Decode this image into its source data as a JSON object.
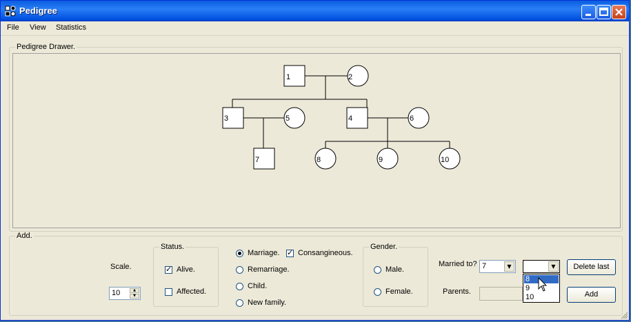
{
  "window": {
    "title": "Pedigree"
  },
  "menu": [
    "File",
    "View",
    "Statistics"
  ],
  "drawer": {
    "label": "Pedigree Drawer.",
    "nodes": [
      {
        "id": "1",
        "shape": "square"
      },
      {
        "id": "2",
        "shape": "circle"
      },
      {
        "id": "3",
        "shape": "square"
      },
      {
        "id": "4",
        "shape": "square"
      },
      {
        "id": "5",
        "shape": "circle"
      },
      {
        "id": "6",
        "shape": "circle"
      },
      {
        "id": "7",
        "shape": "square"
      },
      {
        "id": "8",
        "shape": "circle"
      },
      {
        "id": "9",
        "shape": "circle"
      },
      {
        "id": "10",
        "shape": "circle"
      }
    ]
  },
  "add": {
    "label": "Add.",
    "scale_label": "Scale.",
    "scale_value": "10",
    "status": {
      "label": "Status.",
      "alive_label": "Alive.",
      "alive_checked": true,
      "affected_label": "Affected.",
      "affected_checked": false
    },
    "relation": {
      "marriage_label": "Marriage.",
      "consanguineous_label": "Consangineous.",
      "consanguineous_checked": true,
      "remarriage_label": "Remarriage.",
      "child_label": "Child.",
      "new_family_label": "New family.",
      "selected": "marriage"
    },
    "gender": {
      "label": "Gender.",
      "male_label": "Male.",
      "female_label": "Female."
    },
    "married_to_label": "Married to?",
    "married_to_value": "7",
    "second_select_value": "",
    "dropdown_options": [
      "8",
      "9",
      "10"
    ],
    "dropdown_highlighted": "8",
    "parents_label": "Parents.",
    "delete_last_label": "Delete last",
    "add_label": "Add"
  }
}
